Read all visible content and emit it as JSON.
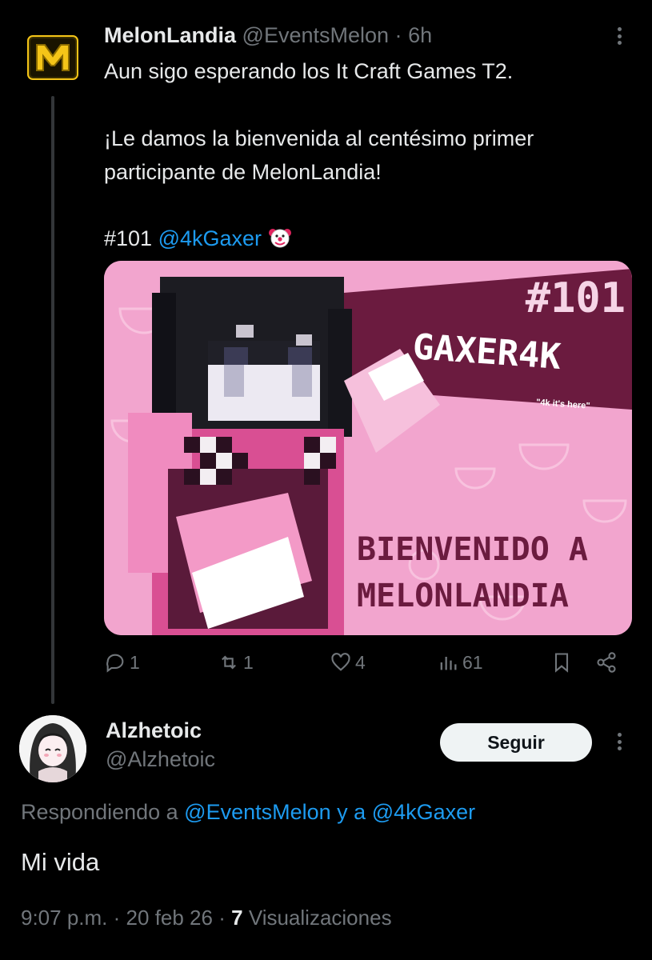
{
  "post": {
    "display_name": "MelonLandia",
    "handle": "@EventsMelon",
    "separator": "·",
    "time": "6h",
    "line1": "Aun sigo esperando los It Craft Games T2.",
    "line2": "¡Le damos la bienvenida al centésimo primer",
    "line3": "participante de MelonLandia!",
    "hashtag": "#101",
    "mention": "@4kGaxer",
    "emoji": "clown-face-icon",
    "image": {
      "number": "#101",
      "player": "GAXER4K",
      "tagline": "\"4k it's here\"",
      "welcome_line1": "BIENVENIDO A",
      "welcome_line2": "MELONLANDIA"
    },
    "actions": {
      "replies": "1",
      "reposts": "1",
      "likes": "4",
      "views": "61"
    }
  },
  "reply": {
    "display_name": "Alzhetoic",
    "handle": "@Alzhetoic",
    "follow_label": "Seguir",
    "replying_prefix": "Respondiendo a ",
    "replying_to_1": "@EventsMelon",
    "replying_joiner": " y a ",
    "replying_to_2": "@4kGaxer",
    "text": "Mi vida",
    "time": "9:07 p.m.",
    "date": "20 feb 26",
    "views_count": "7",
    "views_label": "Visualizaciones"
  },
  "colors": {
    "background": "#000000",
    "text_primary": "#e7e9ea",
    "text_secondary": "#71767b",
    "link": "#1d9bf0",
    "image_pink": "#f2a5ce",
    "image_maroon": "#6b1b3f"
  }
}
